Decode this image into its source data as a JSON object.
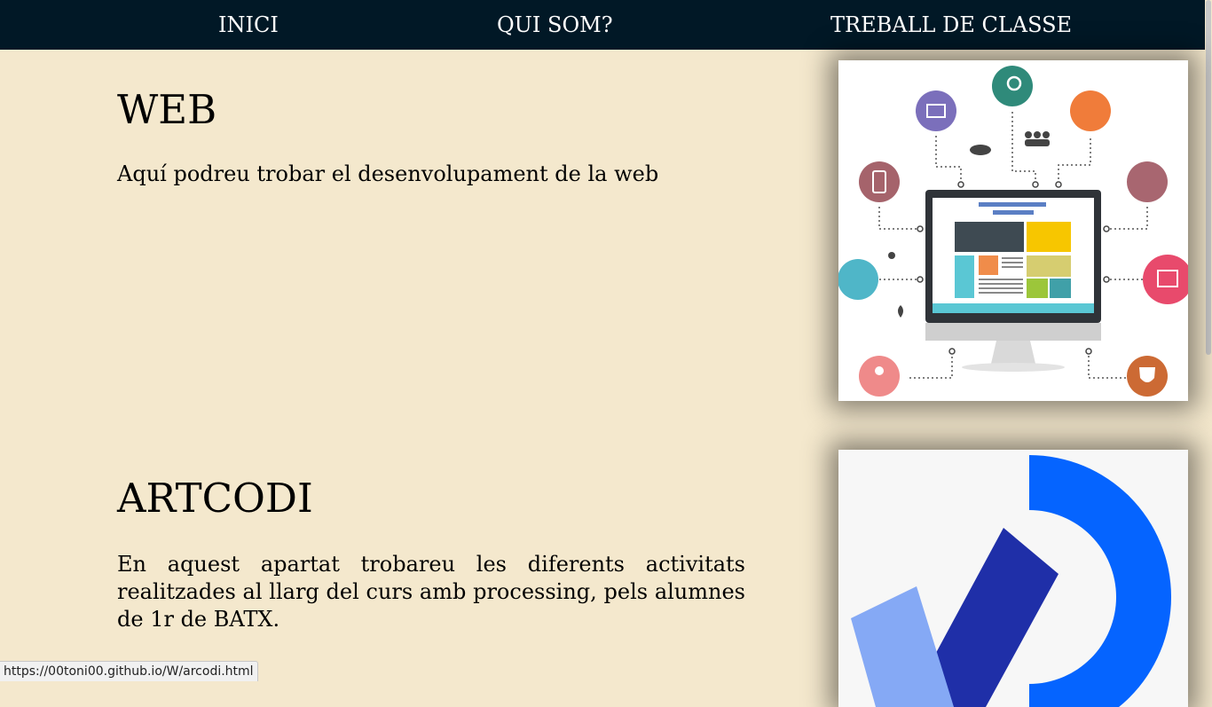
{
  "nav": {
    "items": [
      {
        "label": "INICI"
      },
      {
        "label": "QUI SOM?"
      },
      {
        "label": "TREBALL DE CLASSE"
      }
    ]
  },
  "sections": [
    {
      "title": "WEB",
      "text": "Aquí podreu trobar el desenvolupament de la web",
      "image_icon": "web-development-illustration"
    },
    {
      "title": "ARTCODI",
      "text": "En aquest apartat trobareu les diferents activitats realitzades al llarg del curs amb processing, pels alumnes de 1r de BATX.",
      "image_icon": "processing-logo"
    }
  ],
  "status_bar": {
    "url": "https://00toni00.github.io/W/arcodi.html"
  },
  "colors": {
    "nav_bg": "#011826",
    "page_bg": "#f4e8cd",
    "processing_blue": "#0564ff",
    "processing_dark": "#1f2fa8",
    "processing_light": "#85a9f5"
  }
}
